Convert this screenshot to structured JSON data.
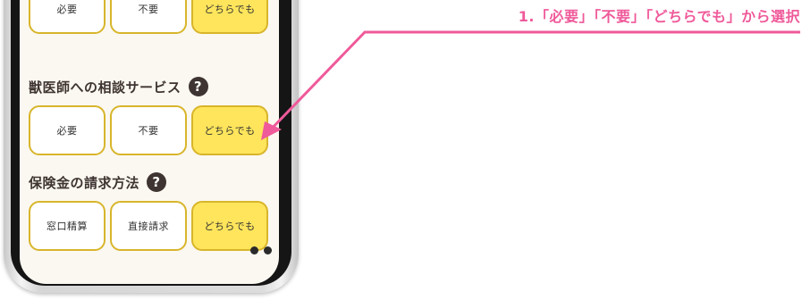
{
  "annotation": {
    "text": "1.「必要」「不要」「どちらでも」から選択",
    "color": "#ef5a9a"
  },
  "section0": {
    "options": [
      "必要",
      "不要",
      "どちらでも"
    ],
    "selected_index": 2
  },
  "section1": {
    "title": "獣医師への相談サービス",
    "help_icon": "question-circle-icon",
    "options": [
      "必要",
      "不要",
      "どちらでも"
    ],
    "selected_index": 2
  },
  "section2": {
    "title": "保険金の請求方法",
    "help_icon": "question-circle-icon",
    "options": [
      "窓口精算",
      "直接請求",
      "どちらでも"
    ],
    "selected_index": 2
  },
  "colors": {
    "selected_fill": "#ffe55b",
    "border": "#d8b52b",
    "title_text": "#3e3431"
  }
}
